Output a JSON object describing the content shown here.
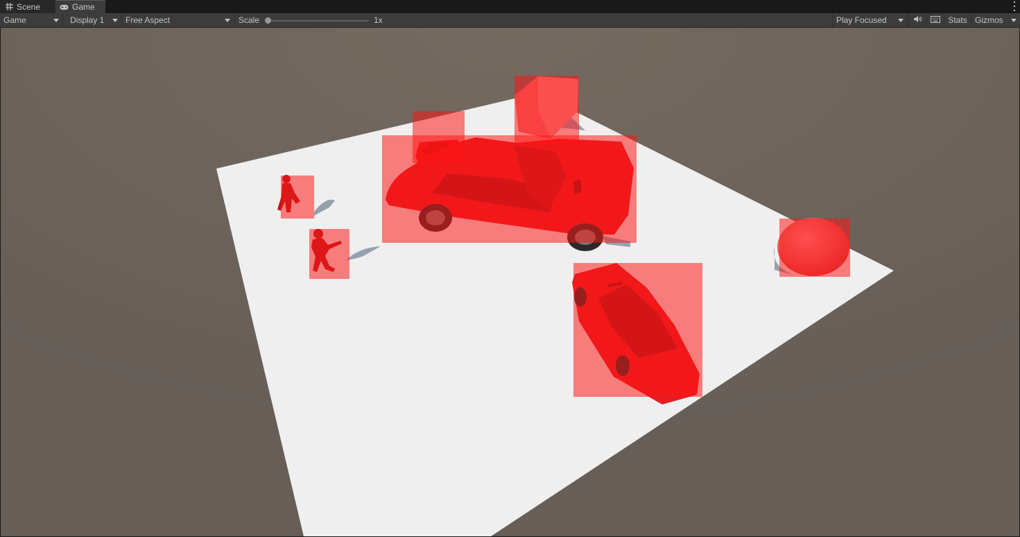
{
  "tabs": [
    {
      "label": "Scene",
      "icon": "grid-icon",
      "active": false
    },
    {
      "label": "Game",
      "icon": "gamepad-icon",
      "active": true
    }
  ],
  "toolbar": {
    "view_mode": "Game",
    "display": "Display 1",
    "aspect": "Free Aspect",
    "scale_label": "Scale",
    "scale_value": "1x",
    "scale_slider_fraction": 0,
    "play_mode": "Play Focused",
    "stats_label": "Stats",
    "gizmos_label": "Gizmos",
    "audio_icon": "speaker-icon",
    "keyboard_icon": "keyboard-icon"
  },
  "scene": {
    "background_color": "#6a625b",
    "ground_color": "#efefef",
    "object_color": "#e41f22",
    "bbox_overlay_color": "rgba(255,20,20,0.52)",
    "objects": [
      "car",
      "car",
      "car",
      "cube",
      "sphere",
      "soldier",
      "soldier"
    ]
  }
}
